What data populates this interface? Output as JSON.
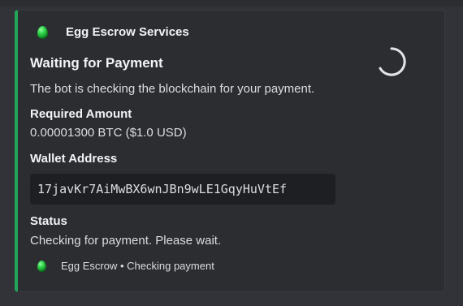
{
  "embed": {
    "accent_color": "#23a559",
    "author": {
      "icon": "green-egg-icon",
      "name": "Egg Escrow Services"
    },
    "title": "Waiting for Payment",
    "description": "The bot is checking the blockchain for your payment.",
    "thumbnail_icon": "loading-spinner-icon",
    "fields": [
      {
        "name": "Required Amount",
        "value": "0.00001300 BTC ($1.0 USD)"
      },
      {
        "name": "Wallet Address",
        "value": "17javKr7AiMwBX6wnJBn9wLE1GqyHuVtEf"
      },
      {
        "name": "Status",
        "value": "Checking for payment. Please wait."
      }
    ],
    "footer": {
      "icon": "green-egg-icon",
      "text": "Egg Escrow • Checking payment"
    }
  }
}
